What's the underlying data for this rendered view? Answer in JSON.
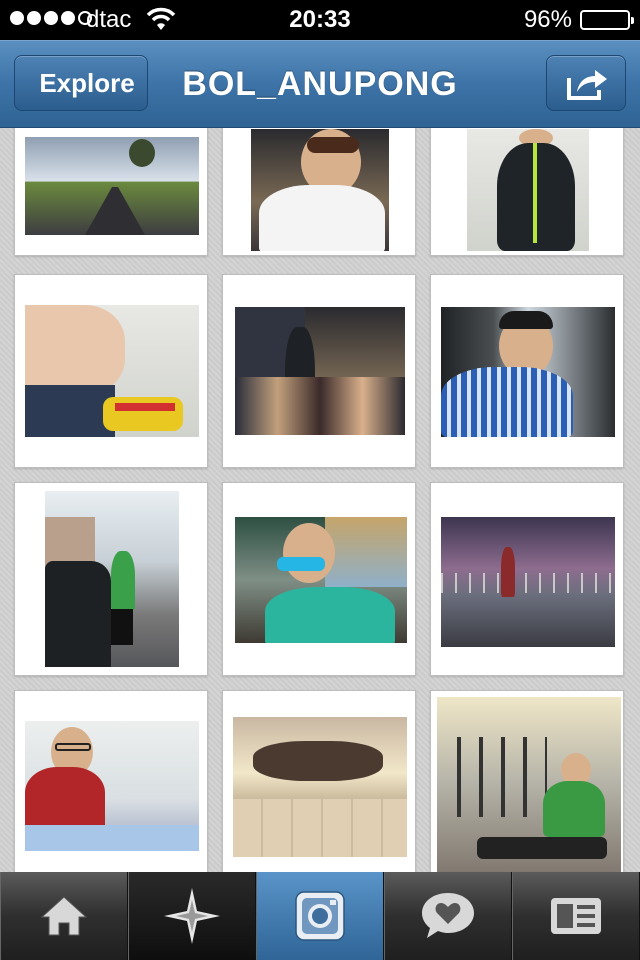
{
  "status_bar": {
    "carrier": "dtac",
    "time": "20:33",
    "battery": "96%"
  },
  "nav": {
    "back_label": "Explore",
    "title": "BOL_ANUPONG"
  },
  "tabs": [
    {
      "name": "home",
      "icon": "home-icon"
    },
    {
      "name": "explore",
      "icon": "compass-star-icon"
    },
    {
      "name": "camera",
      "icon": "camera-icon"
    },
    {
      "name": "activity",
      "icon": "heart-bubble-icon"
    },
    {
      "name": "profile",
      "icon": "profile-card-icon"
    }
  ],
  "colors": {
    "nav_blue": "#3d73a7",
    "active_tab": "#3f79ae",
    "tab_dark": "#1f1f1f"
  },
  "photo_grid": {
    "columns": 3,
    "rows_visible": 4
  }
}
